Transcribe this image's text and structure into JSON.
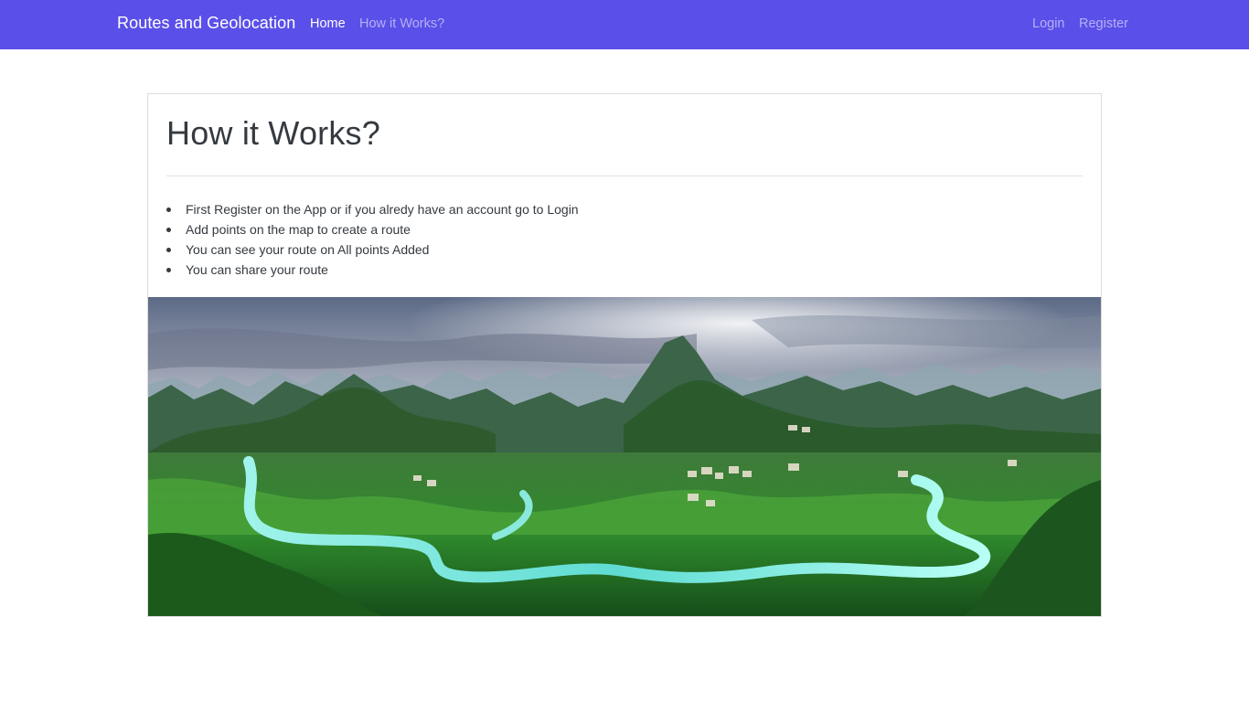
{
  "navbar": {
    "brand": "Routes and Geolocation",
    "links": [
      {
        "label": "Home",
        "active": true
      },
      {
        "label": "How it Works?",
        "active": false
      }
    ],
    "right_links": [
      {
        "label": "Login"
      },
      {
        "label": "Register"
      }
    ],
    "background_color": "#5a4fe8"
  },
  "main": {
    "title": "How it Works?",
    "steps": [
      "First Register on the App or if you alredy have an account go to Login",
      "Add points on the map to create a route",
      "You can see your route on All points Added",
      "You can share your route"
    ],
    "image": {
      "alt": ""
    }
  }
}
